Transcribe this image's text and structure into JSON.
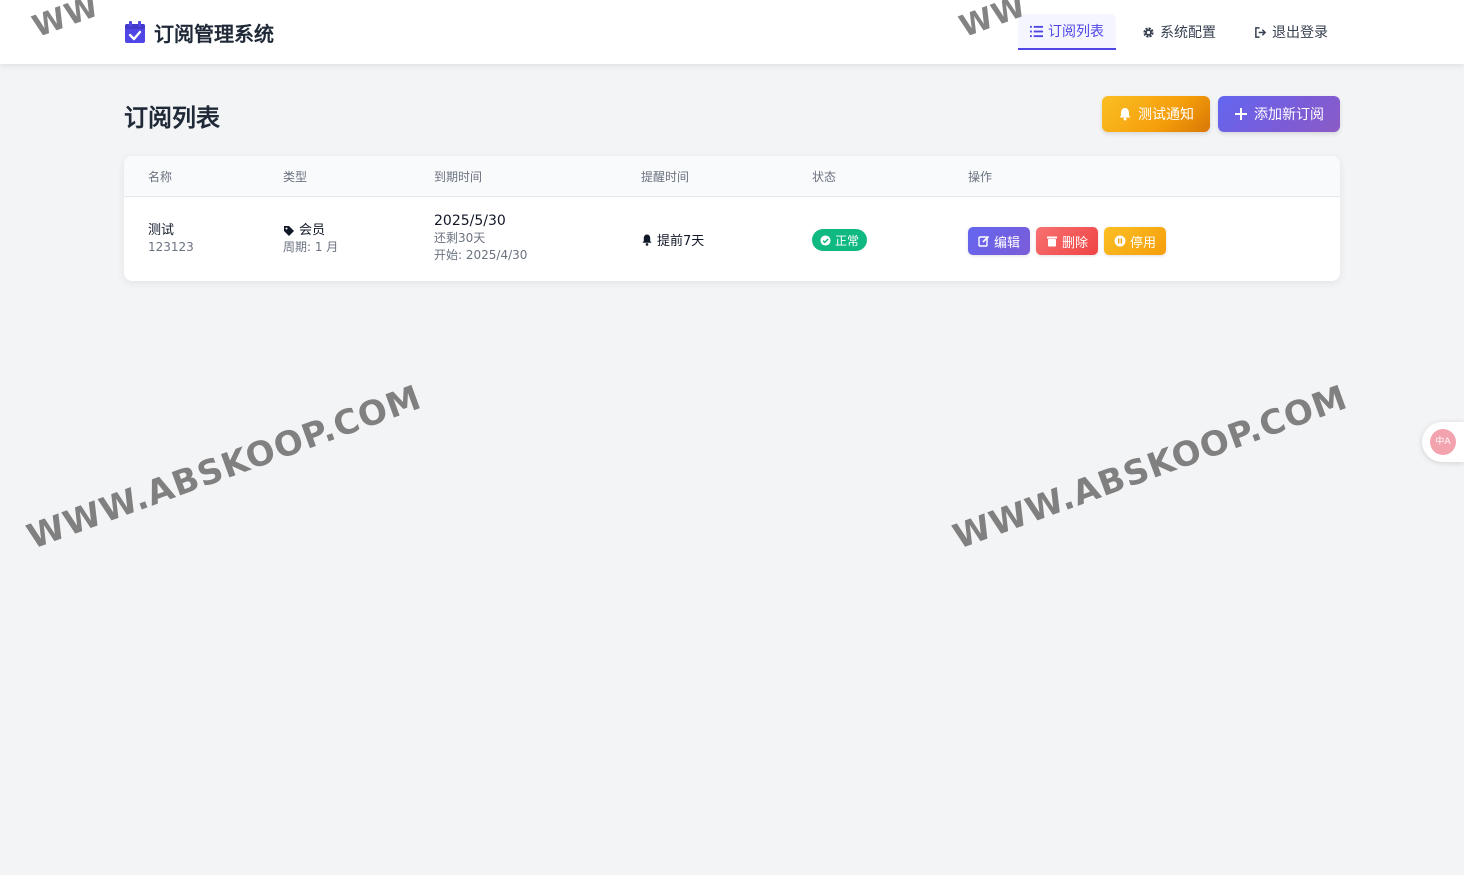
{
  "app": {
    "title": "订阅管理系统"
  },
  "nav": {
    "items": [
      {
        "label": "订阅列表",
        "icon": "list-icon",
        "active": true
      },
      {
        "label": "系统配置",
        "icon": "gear-icon",
        "active": false
      },
      {
        "label": "退出登录",
        "icon": "logout-icon",
        "active": false
      }
    ]
  },
  "page": {
    "title": "订阅列表",
    "test_notify_label": "测试通知",
    "add_label": "添加新订阅"
  },
  "table": {
    "headers": [
      "名称",
      "类型",
      "到期时间",
      "提醒时间",
      "状态",
      "操作"
    ],
    "rows": [
      {
        "name": "测试",
        "note": "123123",
        "type": "会员",
        "period": "周期: 1 月",
        "expire": "2025/5/30",
        "remaining": "还剩30天",
        "start": "开始: 2025/4/30",
        "remind": "提前7天",
        "status": "正常",
        "ops": {
          "edit": "编辑",
          "delete": "删除",
          "disable": "停用"
        }
      }
    ]
  },
  "watermark": {
    "text": "WWW.ABSKOOP.COM",
    "partial": "WW"
  },
  "widget": {
    "text": "中A"
  },
  "colors": {
    "accent": "#4f46e5",
    "warning": "#f59e0b",
    "danger": "#ef4444",
    "success": "#10b981"
  }
}
